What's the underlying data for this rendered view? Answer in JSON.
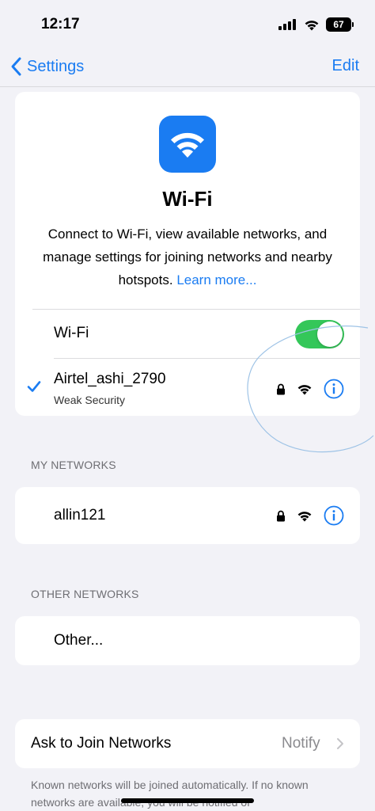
{
  "status_bar": {
    "time": "12:17",
    "battery": "67"
  },
  "nav": {
    "back_label": "Settings",
    "edit_label": "Edit"
  },
  "hero": {
    "title": "Wi-Fi",
    "description": "Connect to Wi-Fi, view available networks, and manage settings for joining networks and nearby hotspots.",
    "learn_more": "Learn more..."
  },
  "wifi_toggle": {
    "label": "Wi-Fi",
    "on": true
  },
  "connected_network": {
    "name": "Airtel_ashi_2790",
    "subtitle": "Weak Security",
    "locked": true
  },
  "my_networks": {
    "header": "MY NETWORKS",
    "items": [
      {
        "name": "allin121",
        "locked": true
      }
    ]
  },
  "other_networks": {
    "header": "OTHER NETWORKS",
    "other_label": "Other..."
  },
  "ask_to_join": {
    "label": "Ask to Join Networks",
    "value": "Notify"
  },
  "footer": {
    "text": "Known networks will be joined automatically. If no known networks are available, you will be notified of"
  },
  "colors": {
    "accent": "#1a7cf2",
    "toggle_on": "#34c759",
    "background": "#f2f2f7"
  },
  "icons": [
    "wifi-icon",
    "lock-icon",
    "info-icon",
    "checkmark-icon",
    "chevron-left-icon",
    "chevron-right-icon",
    "cellular-icon",
    "battery-icon"
  ]
}
